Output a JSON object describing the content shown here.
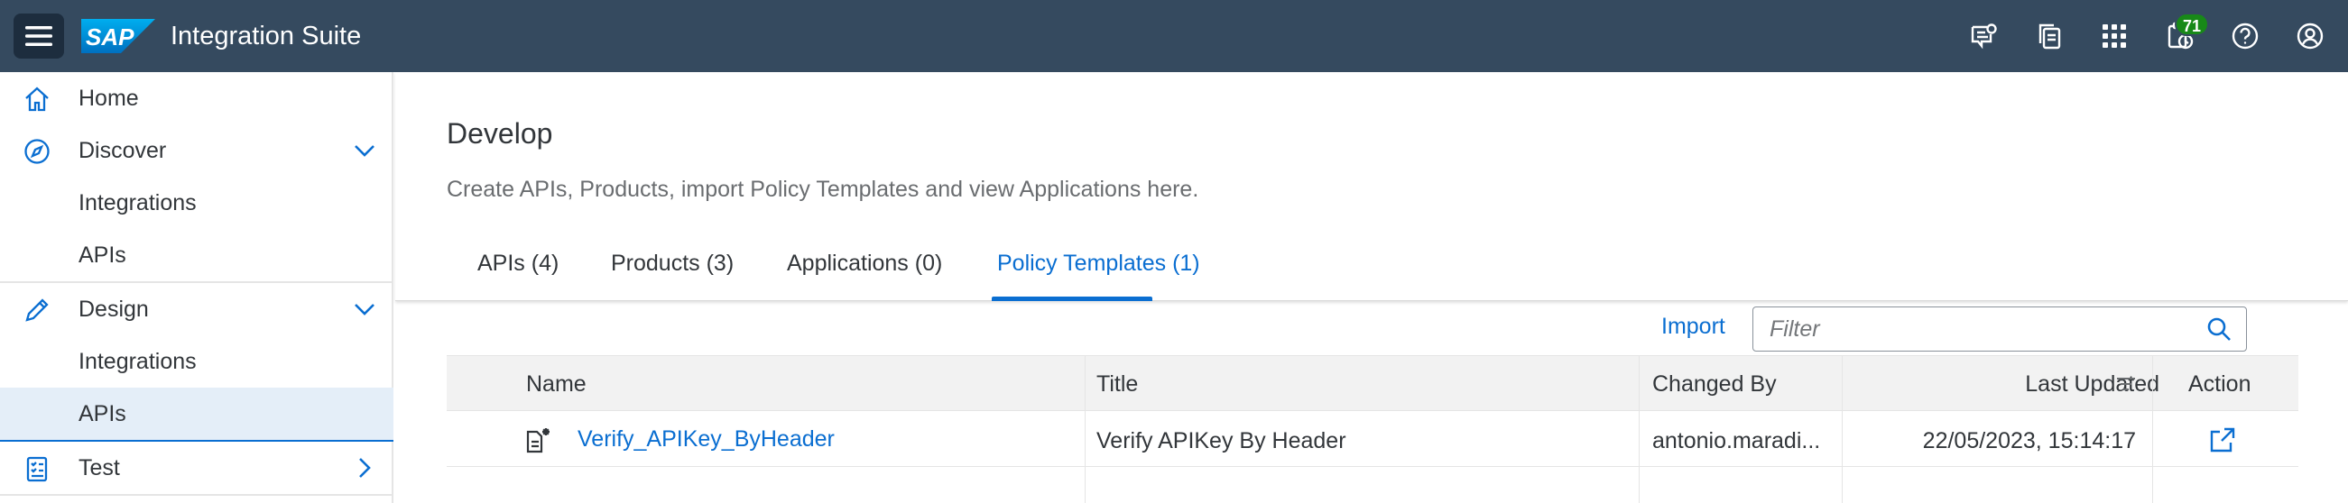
{
  "shell": {
    "logo_text": "SAP",
    "app_title": "Integration Suite",
    "notification_count": "71",
    "icons": [
      "menu-icon",
      "feedback-icon",
      "copy-document-icon",
      "product-switch-icon",
      "activity-icon",
      "help-icon",
      "user-icon"
    ]
  },
  "sidenav": {
    "items": [
      {
        "label": "Home",
        "icon": "home-icon"
      },
      {
        "label": "Discover",
        "icon": "compass-icon"
      },
      {
        "label": "Integrations"
      },
      {
        "label": "APIs"
      },
      {
        "label": "Design",
        "icon": "pencil-icon"
      },
      {
        "label": "Integrations"
      },
      {
        "label": "APIs",
        "selected": true
      },
      {
        "label": "Test",
        "icon": "checklist-icon"
      }
    ]
  },
  "page": {
    "title": "Develop",
    "subtitle": "Create APIs, Products, import Policy Templates and view Applications here.",
    "tabs": [
      {
        "label": "APIs (4)"
      },
      {
        "label": "Products (3)"
      },
      {
        "label": "Applications (0)"
      },
      {
        "label": "Policy Templates (1)",
        "active": true
      }
    ]
  },
  "toolbar": {
    "import_label": "Import",
    "filter_placeholder": "Filter"
  },
  "table": {
    "columns": [
      "Name",
      "Title",
      "Changed By",
      "Last Updated",
      "Action"
    ],
    "rows": [
      {
        "name": "Verify_APIKey_ByHeader",
        "title": "Verify APIKey By Header",
        "changed_by": "antonio.maradi...",
        "last_updated": "22/05/2023, 15:14:17"
      }
    ]
  },
  "colors": {
    "shell_bg": "#354a5f",
    "accent": "#0a6ed1",
    "selected_nav_bg": "#e4eef8",
    "badge": "#188918"
  }
}
